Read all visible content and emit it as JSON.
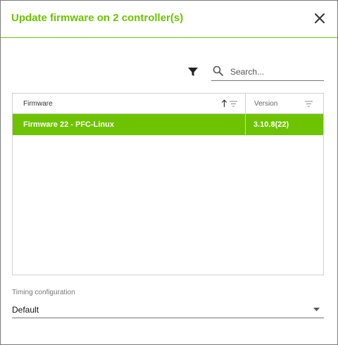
{
  "dialog": {
    "title": "Update firmware on 2 controller(s)"
  },
  "icons": {
    "close": "close-icon",
    "filter": "funnel-icon",
    "search": "search-icon",
    "sort": "sort-ascending-icon",
    "column_filter": "column-filter-icon",
    "dropdown": "chevron-down-icon"
  },
  "toolbar": {
    "search_placeholder": "Search..."
  },
  "grid": {
    "columns": [
      {
        "label": "Firmware",
        "sorted": "ascending"
      },
      {
        "label": "Version"
      }
    ],
    "rows": [
      {
        "firmware": "Firmware 22 - PFC-Linux",
        "version": "3.10.8(22)",
        "selected": true
      }
    ]
  },
  "timing": {
    "label": "Timing configuration",
    "value": "Default"
  },
  "colors": {
    "accent": "#6ec300",
    "border": "#cfcfcf"
  }
}
